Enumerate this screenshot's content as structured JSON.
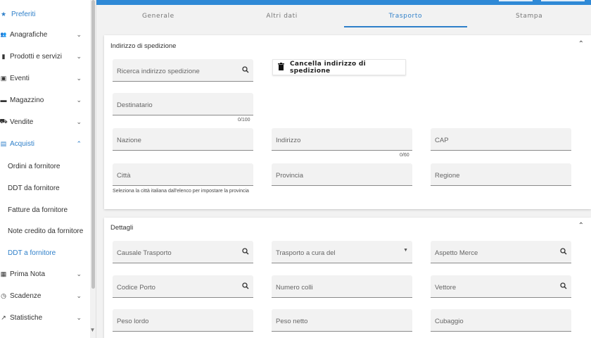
{
  "sidebar": {
    "items": [
      {
        "icon": "star-icon",
        "glyph": "★",
        "label": "Preferiti",
        "chevron": ""
      },
      {
        "icon": "people-icon",
        "glyph": "👥",
        "label": "Anagrafiche",
        "chevron": "⌄"
      },
      {
        "icon": "book-icon",
        "glyph": "▮",
        "label": "Prodotti e servizi",
        "chevron": "⌄"
      },
      {
        "icon": "calendar-icon",
        "glyph": "▣",
        "label": "Eventi",
        "chevron": "⌄"
      },
      {
        "icon": "warehouse-icon",
        "glyph": "▬",
        "label": "Magazzino",
        "chevron": "⌄"
      },
      {
        "icon": "shopping-bag-icon",
        "glyph": "⛟",
        "label": "Vendite",
        "chevron": "⌄"
      },
      {
        "icon": "receipt-icon",
        "glyph": "▤",
        "label": "Acquisti",
        "chevron": "⌃"
      },
      {
        "icon": "ledger-icon",
        "glyph": "▦",
        "label": "Prima Nota",
        "chevron": "⌄"
      },
      {
        "icon": "clock-icon",
        "glyph": "◷",
        "label": "Scadenze",
        "chevron": "⌄"
      },
      {
        "icon": "trending-icon",
        "glyph": "↗",
        "label": "Statistiche",
        "chevron": "⌄"
      }
    ],
    "subitems": [
      {
        "label": "Ordini a fornitore"
      },
      {
        "label": "DDT da fornitore"
      },
      {
        "label": "Fatture da fornitore"
      },
      {
        "label": "Note credito da fornitore"
      },
      {
        "label": "DDT a fornitore"
      }
    ],
    "scroll_down_glyph": "▼"
  },
  "tabs": [
    {
      "label": "Generale"
    },
    {
      "label": "Altri dati"
    },
    {
      "label": "Trasporto"
    },
    {
      "label": "Stampa"
    }
  ],
  "shipping": {
    "title": "Indirizzo di spedizione",
    "collapse_glyph": "⌃",
    "search_placeholder": "Ricerca indirizzo spedizione",
    "delete_button": "Cancella indirizzo di spedizione",
    "destinatario": "Destinatario",
    "destinatario_counter": "0/100",
    "nazione": "Nazione",
    "indirizzo": "Indirizzo",
    "indirizzo_counter": "0/60",
    "cap": "CAP",
    "citta": "Città",
    "citta_hint": "Seleziona la città italiana dall'elenco per impostare la provincia",
    "provincia": "Provincia",
    "regione": "Regione"
  },
  "details": {
    "title": "Dettagli",
    "collapse_glyph": "⌃",
    "causale": "Causale Trasporto",
    "trasporto_cura": "Trasporto a cura del",
    "aspetto": "Aspetto Merce",
    "codice_porto": "Codice Porto",
    "numero_colli": "Numero colli",
    "vettore": "Vettore",
    "peso_lordo": "Peso lordo",
    "peso_netto": "Peso netto",
    "cubaggio": "Cubaggio"
  },
  "colors": {
    "accent": "#2e7fc9",
    "topbar": "#2f89d6"
  }
}
